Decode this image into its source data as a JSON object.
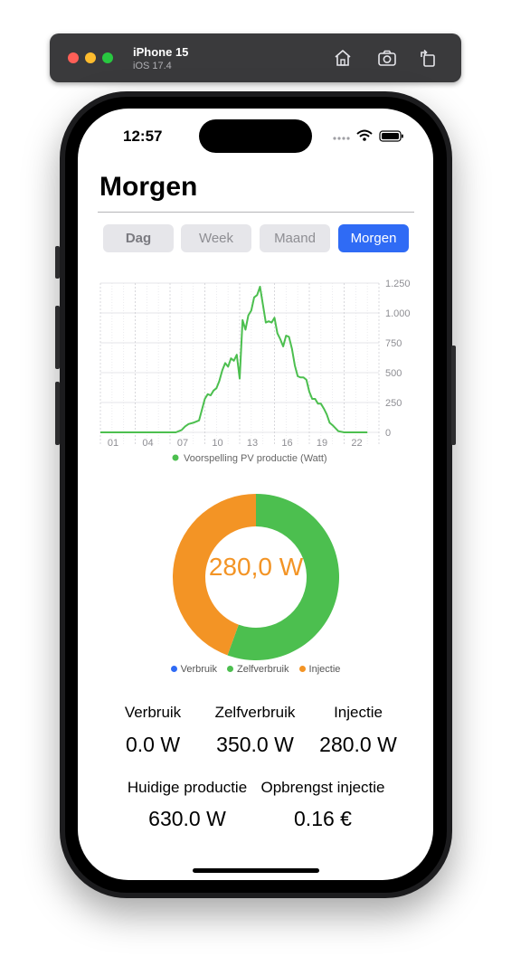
{
  "simulator": {
    "device": "iPhone 15",
    "os": "iOS 17.4"
  },
  "status_bar": {
    "time": "12:57"
  },
  "page": {
    "title": "Morgen"
  },
  "segments": [
    {
      "label": "Dag",
      "selected": false
    },
    {
      "label": "Week",
      "selected": false
    },
    {
      "label": "Maand",
      "selected": false
    },
    {
      "label": "Morgen",
      "selected": true
    }
  ],
  "colors": {
    "accent": "#2f6bf5",
    "pv_line": "#4cbf4f",
    "verbruik": "#2f6bf5",
    "zelfverbruik": "#4cbf4f",
    "injectie": "#f39425"
  },
  "chart_data": [
    {
      "type": "line",
      "x_tick_labels": [
        "01",
        "04",
        "07",
        "10",
        "13",
        "16",
        "19",
        "22"
      ],
      "y_tick_labels": [
        "1.250",
        "1.000",
        "750",
        "500",
        "250",
        "0"
      ],
      "ylim": [
        0,
        1250
      ],
      "xlim": [
        0,
        24
      ],
      "grid": true,
      "legend_position": "bottom",
      "series": [
        {
          "name": "Voorspelling PV productie (Watt)",
          "x": [
            0,
            6.5,
            7,
            7.3,
            7.6,
            8,
            8.5,
            9,
            9.25,
            9.5,
            9.75,
            10,
            10.25,
            10.5,
            10.75,
            11,
            11.25,
            11.5,
            11.75,
            12,
            12.25,
            12.5,
            12.75,
            13,
            13.25,
            13.5,
            13.75,
            14,
            14.25,
            14.5,
            14.75,
            15,
            15.25,
            15.5,
            15.75,
            16,
            16.25,
            16.5,
            16.75,
            17,
            17.25,
            17.5,
            17.75,
            18,
            18.25,
            18.5,
            18.75,
            19,
            19.25,
            19.5,
            19.75,
            20,
            20.5,
            21,
            21.5,
            22,
            22.5,
            23
          ],
          "y": [
            0,
            0,
            20,
            50,
            70,
            80,
            100,
            280,
            320,
            310,
            350,
            370,
            430,
            520,
            580,
            550,
            620,
            600,
            650,
            450,
            940,
            860,
            980,
            1020,
            1130,
            1150,
            1220,
            1070,
            920,
            930,
            920,
            960,
            830,
            780,
            720,
            810,
            800,
            700,
            560,
            470,
            460,
            460,
            440,
            340,
            280,
            280,
            240,
            240,
            200,
            150,
            80,
            60,
            10,
            0,
            0,
            0,
            0,
            0
          ]
        }
      ]
    },
    {
      "type": "pie",
      "center_label": "280,0 W",
      "legend_position": "bottom",
      "series": [
        {
          "name": "Verbruik",
          "value": 0.0
        },
        {
          "name": "Zelfverbruik",
          "value": 350.0
        },
        {
          "name": "Injectie",
          "value": 280.0
        }
      ]
    }
  ],
  "stats": {
    "verbruik_label": "Verbruik",
    "verbruik_value": "0.0 W",
    "zelfverbruik_label": "Zelfverbruik",
    "zelfverbruik_value": "350.0 W",
    "injectie_label": "Injectie",
    "injectie_value": "280.0 W",
    "huidige_label": "Huidige productie",
    "huidige_value": "630.0 W",
    "opbrengst_label": "Opbrengst injectie",
    "opbrengst_value": "0.16 €"
  }
}
